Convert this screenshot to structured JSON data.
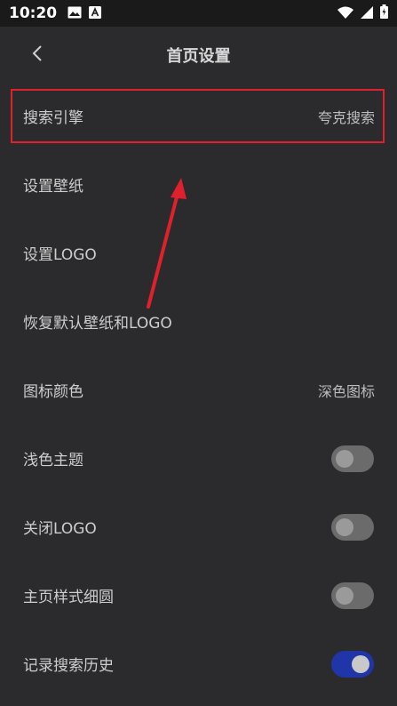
{
  "status_bar": {
    "time": "10:20",
    "left_icons": [
      "image-icon",
      "a-notification-icon"
    ],
    "right_icons": [
      "wifi-icon",
      "signal-icon",
      "battery-icon"
    ]
  },
  "header": {
    "back_icon": "chevron-left-icon",
    "title": "首页设置"
  },
  "settings": [
    {
      "label": "搜索引擎",
      "value": "夸克搜索"
    },
    {
      "label": "设置壁纸"
    },
    {
      "label": "设置LOGO"
    },
    {
      "label": "恢复默认壁纸和LOGO"
    },
    {
      "label": "图标颜色",
      "value": "深色图标"
    },
    {
      "label": "浅色主题",
      "toggle": false
    },
    {
      "label": "关闭LOGO",
      "toggle": false
    },
    {
      "label": "主页样式细圆",
      "toggle": false
    },
    {
      "label": "记录搜索历史",
      "toggle": true
    }
  ],
  "colors": {
    "background": "#2b2b2d",
    "status_bar": "#1a1a1b",
    "highlight": "#e0202c",
    "toggle_on": "#1f35a8",
    "toggle_off": "#6b6b6b"
  }
}
